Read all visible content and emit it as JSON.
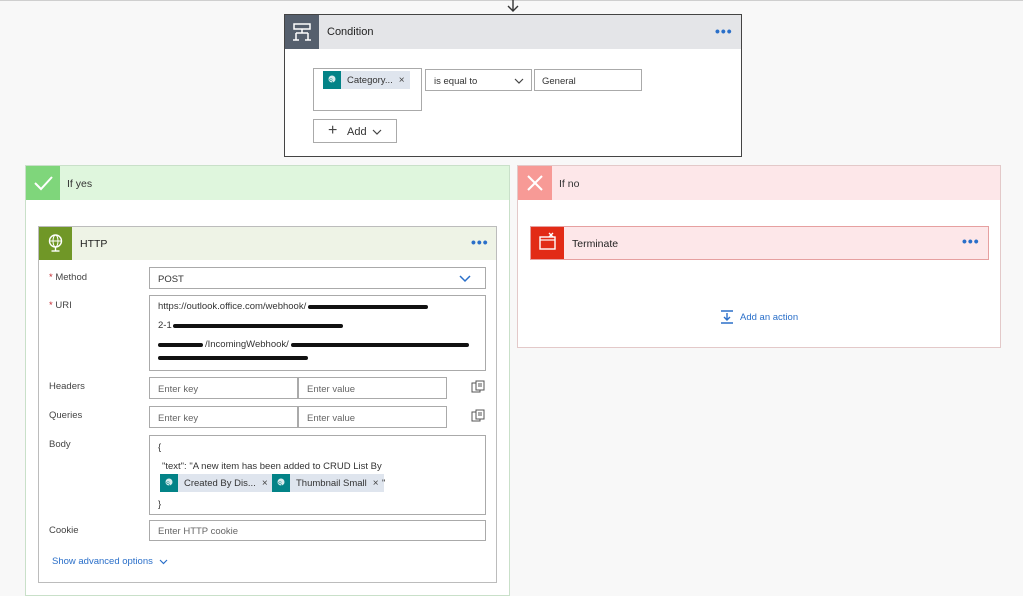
{
  "condition": {
    "title": "Condition",
    "more": "•••",
    "left_token": {
      "label": "Category...",
      "remove": "×"
    },
    "operator": "is equal to",
    "value": "General",
    "add_button": "Add"
  },
  "if_yes": {
    "label": "If yes",
    "http": {
      "title": "HTTP",
      "more": "•••",
      "method_label": "Method",
      "method_value": "POST",
      "uri_label": "URI",
      "uri_line1": "https://outlook.office.com/webhook/",
      "uri_line2": "2-1",
      "uri_line3": "/IncomingWebhook/",
      "uri_line4": "",
      "headers_label": "Headers",
      "queries_label": "Queries",
      "key_placeholder": "Enter key",
      "value_placeholder": "Enter value",
      "body_label": "Body",
      "body_open": "{",
      "body_text": "\"text\": \"A new item has been added to CRUD List By",
      "body_token1": {
        "label": "Created By Dis...",
        "remove": "×"
      },
      "body_token2": {
        "label": "Thumbnail Small",
        "remove": "×"
      },
      "body_quote": "\"",
      "body_close": "}",
      "cookie_label": "Cookie",
      "cookie_placeholder": "Enter HTTP cookie",
      "advanced": "Show advanced options"
    }
  },
  "if_no": {
    "label": "If no",
    "terminate": {
      "title": "Terminate",
      "more": "•••"
    },
    "add_action": "Add an action"
  },
  "colors": {
    "accent": "#2a6fc9",
    "condition_icon": "#555f6d",
    "yes": "#7fd67b",
    "no": "#f79a96",
    "http": "#709727",
    "terminate": "#e22b16",
    "token": "#038387"
  }
}
